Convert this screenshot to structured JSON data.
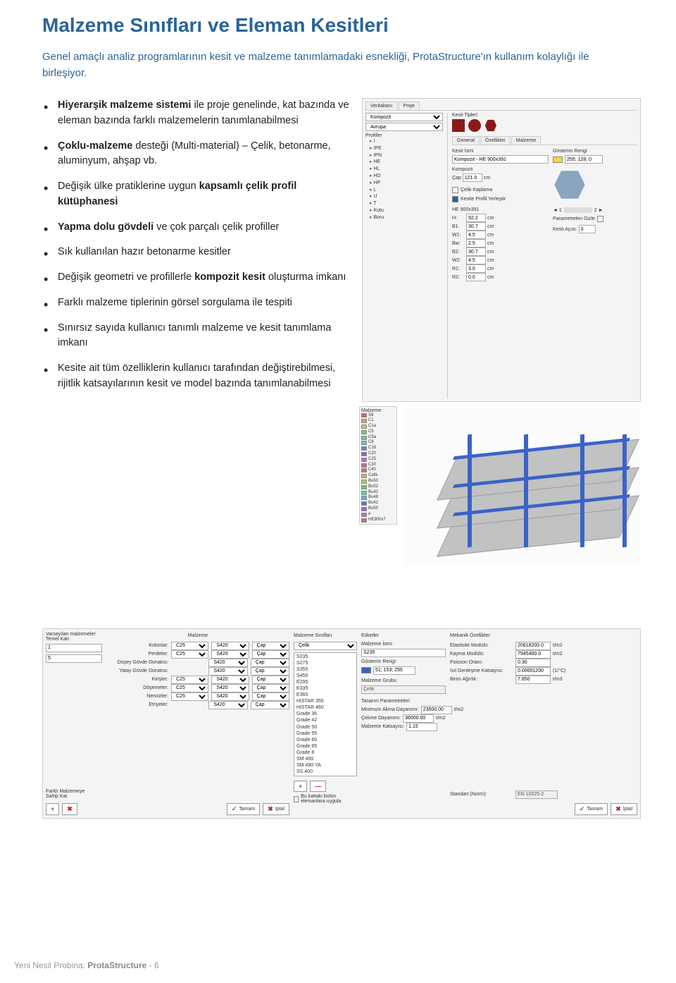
{
  "title": "Malzeme Sınıfları ve Eleman Kesitleri",
  "intro": "Genel amaçlı analiz programlarının kesit ve malzeme tanımlamadaki esnekliği, ProtaStructure'ın kullanım kolaylığı ile birleşiyor.",
  "bullets": [
    {
      "pre": "",
      "b": "Hiyerarşik malzeme sistemi",
      "post": " ile proje genelinde, kat bazında ve eleman bazında farklı malzemelerin tanımlanabilmesi"
    },
    {
      "pre": "",
      "b": "Çoklu-malzeme",
      "post": " desteği (Multi-material) – Çelik, betonarme, aluminyum, ahşap vb."
    },
    {
      "pre": "Değişik ülke pratiklerine uygun ",
      "b": "kapsamlı çelik profil kütüphanesi",
      "post": ""
    },
    {
      "pre": "",
      "b": "Yapma dolu gövdeli",
      "post": " ve çok parçalı çelik profiller"
    },
    {
      "pre": "Sık kullanılan hazır betonarme kesitler",
      "b": "",
      "post": ""
    },
    {
      "pre": "Değişik geometri ve profillerle ",
      "b": "kompozit kesit",
      "post": " oluşturma imkanı"
    },
    {
      "pre": "Farklı malzeme tiplerinin görsel sorgulama ile tespiti",
      "b": "",
      "post": ""
    },
    {
      "pre": "Sınırsız sayıda kullanıcı tanımlı malzeme ve kesit tanımlama imkanı",
      "b": "",
      "post": ""
    },
    {
      "pre": "Kesite ait tüm özelliklerin kullanıcı tarafından değiştirebilmesi, rijitlik katsayılarının kesit ve model bazında tanımlanabilmesi",
      "b": "",
      "post": ""
    }
  ],
  "panelA": {
    "tab1": "Veritabanı",
    "tab2": "Proje",
    "dd_top1": "Kompozit",
    "dd_top2": "Avrupa",
    "profiller": "Profiller",
    "tree": [
      "I",
      "IPE",
      "IPN",
      "HE",
      "HL",
      "HD",
      "HP",
      "L",
      "U",
      "T",
      "Kutu",
      "Boru"
    ],
    "kesit_tipleri": "Kesit Tipleri",
    "tabM1": "General",
    "tabM2": "Özellikler",
    "tabM3": "Malzeme",
    "kesit_ismi_lbl": "Kesit İsmi",
    "kesit_ismi_val": "Kompozit - HE 900x391",
    "renk_lbl": "Gösterim Rengi",
    "renk_val": "255; 128; 0",
    "kompozit_lbl": "Kompozit",
    "cap_lbl": "Çap",
    "cap_val": "121.0",
    "cap_unit": "cm",
    "celik_kaplama": "Çelik Kaplama",
    "yerlestir_lbl": "Kesite Profil Yerleştir",
    "param_gizle": "Parametreleri Gizle",
    "kesit_agisi": "Kesit Açısı:",
    "kesit_agisi_val": "0",
    "profile_name": "HE 900x391",
    "dims": [
      {
        "k": "H:",
        "v": "92.2",
        "u": "cm"
      },
      {
        "k": "B1:",
        "v": "30.7",
        "u": "cm"
      },
      {
        "k": "W1:",
        "v": "4.5",
        "u": "cm"
      },
      {
        "k": "Bw:",
        "v": "2.5",
        "u": "cm"
      },
      {
        "k": "B2:",
        "v": "30.7",
        "u": "cm"
      },
      {
        "k": "W2:",
        "v": "4.5",
        "u": "cm"
      },
      {
        "k": "R1:",
        "v": "3.0",
        "u": "cm"
      },
      {
        "k": "R2:",
        "v": "0.0",
        "u": "cm"
      }
    ]
  },
  "legend": {
    "title": "Malzeme",
    "items": [
      "S8",
      "C1",
      "C1a",
      "C5",
      "C5a",
      "C8",
      "C18",
      "C20",
      "C25",
      "C30",
      "C40",
      "Celik",
      "Bu50",
      "Bu52",
      "Bu42",
      "Bu48",
      "Bu42",
      "Bu50",
      "e",
      "HE900x7"
    ]
  },
  "panelB": {
    "c1_lbl": "Varsayılan malzemeler\nTemel Katı",
    "c1_row1": "1",
    "c1_row2": "5",
    "c2_hdr": "Malzeme",
    "rows": [
      {
        "n": "Kolonlar:",
        "a": "C25",
        "b": "S420",
        "c": "Çap"
      },
      {
        "n": "Perdeler:",
        "a": "C25",
        "b": "S420",
        "c": "Çap"
      },
      {
        "n": "Düşey Gövde Donatısı:",
        "a": "",
        "b": "S420",
        "c": "Çap"
      },
      {
        "n": "Yatay Gövde Donatısı:",
        "a": "",
        "b": "S420",
        "c": "Çap"
      },
      {
        "n": "Kirişler:",
        "a": "C25",
        "b": "S420",
        "c": "Çap"
      },
      {
        "n": "Döşemeler:",
        "a": "C25",
        "b": "S420",
        "c": "Çap"
      },
      {
        "n": "Nervürler:",
        "a": "C25",
        "b": "S420",
        "c": "Çap"
      },
      {
        "n": "Etriyeler:",
        "a": "",
        "b": "S420",
        "c": "Çap"
      }
    ],
    "c3_hdr": "Malzeme Sınıfları",
    "c3_sel": "Çelik",
    "steel_list": [
      "S235",
      "S275",
      "S355",
      "S450",
      "E295",
      "E335",
      "E360",
      "HISTAR 355",
      "HISTAR 460",
      "Grade 36",
      "Grade 42",
      "Grade 50",
      "Grade 55",
      "Grade 60",
      "Grade 65",
      "Grade 8",
      "SM 400",
      "SM 490 YA",
      "SS 400"
    ],
    "c4_hdr": "Etiketler",
    "mi_lbl": "Malzeme İsmi:",
    "mi_val": "S235",
    "rk_lbl": "Gösterim Rengi:",
    "rk_val": "51; 153; 255",
    "grp_lbl": "Malzeme Grubu:",
    "grp_val": "Çelik",
    "tas_lbl": "Tasarım Parametreleri",
    "c5_hdr": "Mekanik Özellikler",
    "props": [
      {
        "k": "Elastisite Modülü:",
        "v": "20618200.0",
        "u": "t/m2"
      },
      {
        "k": "Kayma Modülü:",
        "v": "7945400.0",
        "u": "t/m2"
      },
      {
        "k": "Poisson Oranı:",
        "v": "0.30",
        "u": ""
      },
      {
        "k": "Isıl Genleşme Katsayısı:",
        "v": "0.00001200",
        "u": "(1/°C)"
      },
      {
        "k": "Birim Ağırlık:",
        "v": "7.850",
        "u": "t/m3"
      }
    ],
    "props2": [
      {
        "k": "Minimum Akma Dayanımı:",
        "v": "23500.00",
        "u": "t/m2"
      },
      {
        "k": "Çekme Dayanımı:",
        "v": "36000.00",
        "u": "t/m2"
      },
      {
        "k": "Malzeme Katsayısı:",
        "v": "1.15",
        "u": ""
      }
    ],
    "fk_lbl": "Farklı Malzemeye\nSahip Kat",
    "tamam": "Tamam",
    "iptal": "İptal",
    "std_lbl": "Standart (Norm):",
    "std_val": "EN 10025-2",
    "uygula": "Bu kattaki bütün elemanlara uygula"
  },
  "footer_pre": "Yeni Nesil Probina: ",
  "footer_b": "ProtaStructure",
  "footer_post": " - 6"
}
